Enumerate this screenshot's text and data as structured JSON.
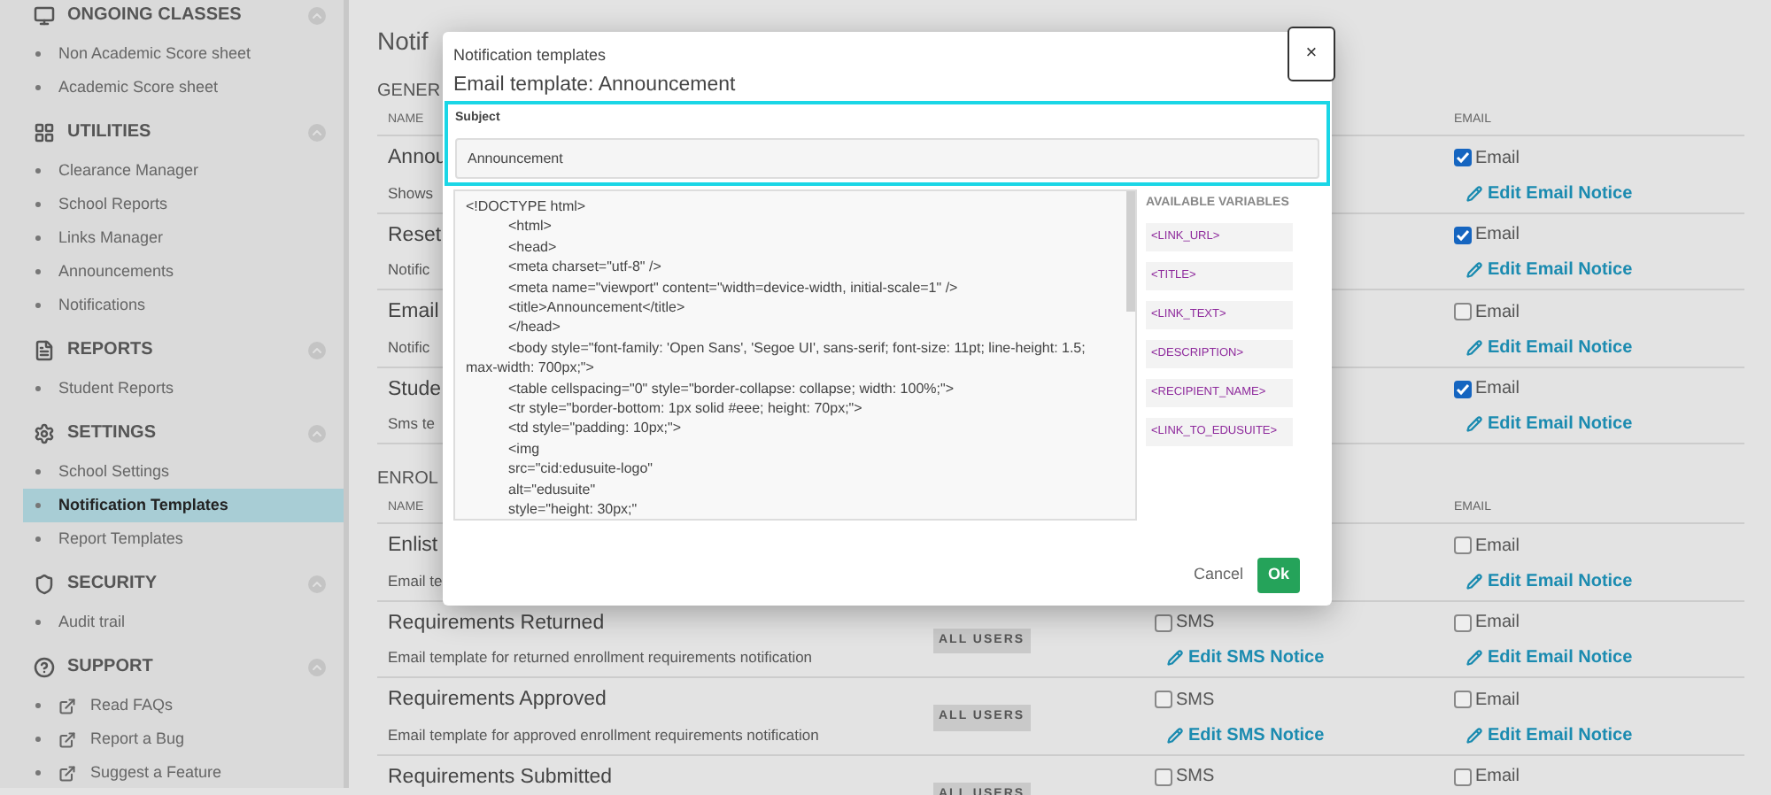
{
  "sidebar": {
    "sections": [
      {
        "title": "ONGOING CLASSES",
        "items": [
          {
            "label": "Non Academic Score sheet",
            "kind": "page",
            "selected": false
          },
          {
            "label": "Academic Score sheet",
            "kind": "page",
            "selected": false
          }
        ]
      },
      {
        "title": "UTILITIES",
        "items": [
          {
            "label": "Clearance Manager",
            "kind": "page",
            "selected": false
          },
          {
            "label": "School Reports",
            "kind": "page",
            "selected": false
          },
          {
            "label": "Links Manager",
            "kind": "page",
            "selected": false
          },
          {
            "label": "Announcements",
            "kind": "page",
            "selected": false
          },
          {
            "label": "Notifications",
            "kind": "page",
            "selected": false
          }
        ]
      },
      {
        "title": "REPORTS",
        "items": [
          {
            "label": "Student Reports",
            "kind": "page",
            "selected": false
          }
        ]
      },
      {
        "title": "SETTINGS",
        "items": [
          {
            "label": "School Settings",
            "kind": "page",
            "selected": false
          },
          {
            "label": "Notification Templates",
            "kind": "page",
            "selected": true
          },
          {
            "label": "Report Templates",
            "kind": "page",
            "selected": false
          }
        ]
      },
      {
        "title": "SECURITY",
        "items": [
          {
            "label": "Audit trail",
            "kind": "page",
            "selected": false
          }
        ]
      },
      {
        "title": "SUPPORT",
        "items": [
          {
            "label": "Read FAQs",
            "kind": "external",
            "selected": false
          },
          {
            "label": "Report a Bug",
            "kind": "external",
            "selected": false
          },
          {
            "label": "Suggest a Feature",
            "kind": "external",
            "selected": false
          }
        ]
      }
    ]
  },
  "main": {
    "title": "Notif",
    "sections": [
      {
        "title": "GENER",
        "columns": {
          "name": "NAME",
          "email": "EMAIL"
        },
        "rows": [
          {
            "name": "Annou",
            "description": "Shows",
            "email": {
              "label": "Email",
              "checked": true,
              "link": "Edit Email Notice"
            }
          },
          {
            "name": "Reset",
            "description": "Notific",
            "email": {
              "label": "Email",
              "checked": true,
              "link": "Edit Email Notice"
            }
          },
          {
            "name": "Email",
            "description": "Notific",
            "email": {
              "label": "Email",
              "checked": false,
              "link": "Edit Email Notice"
            }
          },
          {
            "name": "Stude",
            "description": "Sms te",
            "email": {
              "label": "Email",
              "checked": true,
              "link": "Edit Email Notice"
            }
          }
        ]
      },
      {
        "title": "ENROL",
        "columns": {
          "name": "NAME",
          "email": "EMAIL"
        },
        "rows": [
          {
            "name": "Enlist",
            "description": "Email te",
            "email": {
              "label": "Email",
              "checked": false,
              "link": "Edit Email Notice"
            }
          },
          {
            "name": "Requirements Returned",
            "description": "Email template for returned enrollment requirements notification",
            "audience": "ALL USERS",
            "sms": {
              "label": "SMS",
              "checked": false,
              "link": "Edit SMS Notice"
            },
            "email": {
              "label": "Email",
              "checked": false,
              "link": "Edit Email Notice"
            }
          },
          {
            "name": "Requirements Approved",
            "description": "Email template for approved enrollment requirements notification",
            "audience": "ALL USERS",
            "sms": {
              "label": "SMS",
              "checked": false,
              "link": "Edit SMS Notice"
            },
            "email": {
              "label": "Email",
              "checked": false,
              "link": "Edit Email Notice"
            }
          },
          {
            "name": "Requirements Submitted",
            "audience": "ALL USERS",
            "sms": {
              "label": "SMS",
              "checked": false
            },
            "email": {
              "label": "Email",
              "checked": false
            }
          }
        ]
      }
    ]
  },
  "modal": {
    "title": "Notification templates",
    "close": "×",
    "heading": "Email template: Announcement",
    "subject": {
      "label": "Subject",
      "value": "Announcement",
      "focused": true
    },
    "body": [
      {
        "text": "<!DOCTYPE html>",
        "indented": false
      },
      {
        "text": "<html>",
        "indented": true
      },
      {
        "text": "<head>",
        "indented": true
      },
      {
        "text": "<meta charset=\"utf-8\" />",
        "indented": true
      },
      {
        "text": "<meta name=\"viewport\" content=\"width=device-width, initial-scale=1\" />",
        "indented": true
      },
      {
        "text": "<title>Announcement</title>",
        "indented": true
      },
      {
        "text": "</head>",
        "indented": true
      },
      {
        "text": "<body style=\"font-family: 'Open Sans', 'Segoe UI', sans-serif; font-size: 11pt; line-height: 1.5; max-width: 700px;\">",
        "indented": true
      },
      {
        "text": "<table cellspacing=\"0\" style=\"border-collapse: collapse; width: 100%;\">",
        "indented": true
      },
      {
        "text": "<tr style=\"border-bottom: 1px solid #eee; height: 70px;\">",
        "indented": true
      },
      {
        "text": "<td style=\"padding: 10px;\">",
        "indented": true
      },
      {
        "text": "<img",
        "indented": true
      },
      {
        "text": "src=\"cid:edusuite-logo\"",
        "indented": true
      },
      {
        "text": "alt=\"edusuite\"",
        "indented": true
      },
      {
        "text": "style=\"height: 30px;\"",
        "indented": true
      }
    ],
    "variables": {
      "title": "AVAILABLE VARIABLES",
      "items": [
        "<LINK_URL>",
        "<TITLE>",
        "<LINK_TEXT>",
        "<DESCRIPTION>",
        "<RECIPIENT_NAME>",
        "<LINK_TO_EDUSUITE>"
      ]
    },
    "buttons": {
      "cancel": "Cancel",
      "ok": "Ok"
    }
  }
}
